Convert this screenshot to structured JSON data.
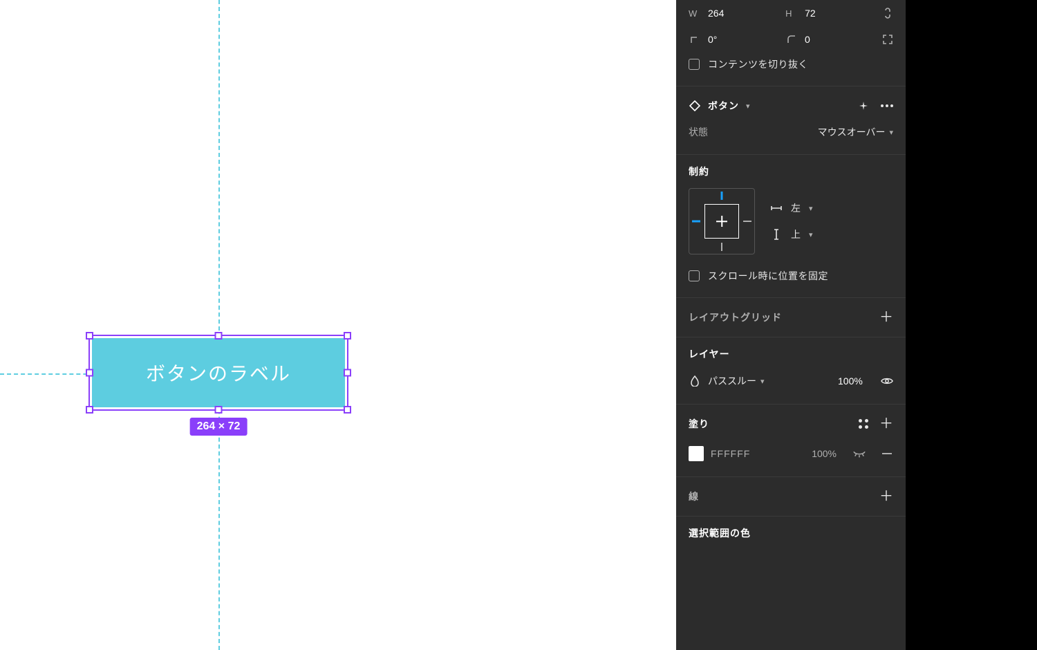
{
  "canvas": {
    "button_label": "ボタンのラベル",
    "dim_badge": "264 × 72"
  },
  "transform": {
    "w_label": "W",
    "w_value": "264",
    "h_label": "H",
    "h_value": "72",
    "rot_value": "0°",
    "radius_value": "0",
    "clip_label": "コンテンツを切り抜く"
  },
  "component": {
    "title": "ボタン",
    "state_label": "状態",
    "state_value": "マウスオーバー"
  },
  "constraints": {
    "title": "制約",
    "h_value": "左",
    "v_value": "上",
    "fix_label": "スクロール時に位置を固定"
  },
  "layout_grid": {
    "title": "レイアウトグリッド"
  },
  "layer": {
    "title": "レイヤー",
    "blend": "パススルー",
    "opacity": "100%"
  },
  "fill": {
    "title": "塗り",
    "hex": "FFFFFF",
    "opacity": "100%"
  },
  "stroke": {
    "title": "線"
  },
  "selection_colors": {
    "title": "選択範囲の色"
  }
}
